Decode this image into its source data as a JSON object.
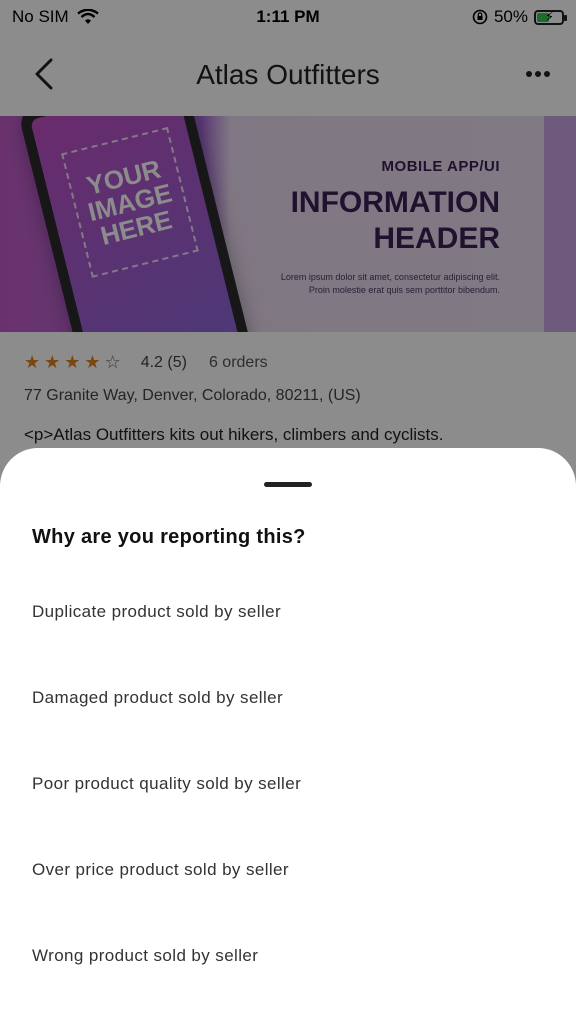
{
  "status_bar": {
    "carrier": "No SIM",
    "time": "1:11 PM",
    "battery_percent": "50%",
    "battery_level": 0.5,
    "battery_color": "#34c759"
  },
  "nav": {
    "title": "Atlas Outfitters",
    "back_icon": "chevron-left-icon",
    "more_icon": "ellipsis-icon"
  },
  "banner": {
    "placeholder_lines": [
      "YOUR",
      "IMAGE",
      "HERE"
    ],
    "tag": "MOBILE APP/UI",
    "title_line1": "INFORMATION",
    "title_line2": "HEADER",
    "desc_line1": "Lorem ipsum dolor sit amet, consectetur adipiscing elit.",
    "desc_line2": "Proin molestie erat quis sem porttitor bibendum."
  },
  "store": {
    "rating": 4,
    "rating_max": 5,
    "rating_text": "4.2 (5)",
    "orders": "6 orders",
    "address": "77 Granite Way, Denver, Colorado, 80211, (US)",
    "description": "<p>Atlas Outfitters kits out hikers, climbers and cyclists."
  },
  "report_sheet": {
    "title": "Why are you reporting this?",
    "options": [
      "Duplicate product sold by seller",
      "Damaged product sold by seller",
      "Poor product quality sold by seller",
      "Over price product sold by seller",
      "Wrong product sold by seller"
    ]
  },
  "colors": {
    "star_filled": "#e0801f",
    "overlay": "rgba(0,0,0,0.45)"
  }
}
